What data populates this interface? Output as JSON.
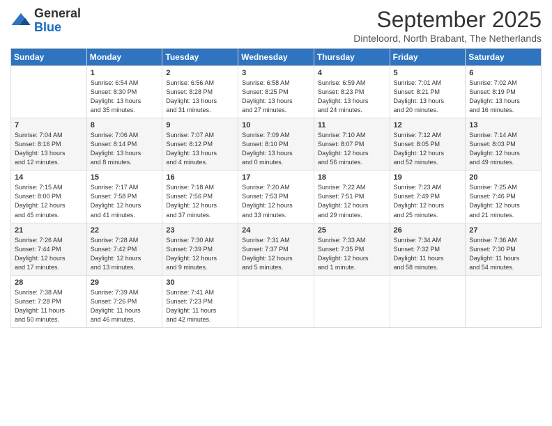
{
  "logo": {
    "general": "General",
    "blue": "Blue"
  },
  "title": "September 2025",
  "subtitle": "Dinteloord, North Brabant, The Netherlands",
  "weekdays": [
    "Sunday",
    "Monday",
    "Tuesday",
    "Wednesday",
    "Thursday",
    "Friday",
    "Saturday"
  ],
  "weeks": [
    [
      {
        "day": "",
        "info": ""
      },
      {
        "day": "1",
        "info": "Sunrise: 6:54 AM\nSunset: 8:30 PM\nDaylight: 13 hours\nand 35 minutes."
      },
      {
        "day": "2",
        "info": "Sunrise: 6:56 AM\nSunset: 8:28 PM\nDaylight: 13 hours\nand 31 minutes."
      },
      {
        "day": "3",
        "info": "Sunrise: 6:58 AM\nSunset: 8:25 PM\nDaylight: 13 hours\nand 27 minutes."
      },
      {
        "day": "4",
        "info": "Sunrise: 6:59 AM\nSunset: 8:23 PM\nDaylight: 13 hours\nand 24 minutes."
      },
      {
        "day": "5",
        "info": "Sunrise: 7:01 AM\nSunset: 8:21 PM\nDaylight: 13 hours\nand 20 minutes."
      },
      {
        "day": "6",
        "info": "Sunrise: 7:02 AM\nSunset: 8:19 PM\nDaylight: 13 hours\nand 16 minutes."
      }
    ],
    [
      {
        "day": "7",
        "info": "Sunrise: 7:04 AM\nSunset: 8:16 PM\nDaylight: 13 hours\nand 12 minutes."
      },
      {
        "day": "8",
        "info": "Sunrise: 7:06 AM\nSunset: 8:14 PM\nDaylight: 13 hours\nand 8 minutes."
      },
      {
        "day": "9",
        "info": "Sunrise: 7:07 AM\nSunset: 8:12 PM\nDaylight: 13 hours\nand 4 minutes."
      },
      {
        "day": "10",
        "info": "Sunrise: 7:09 AM\nSunset: 8:10 PM\nDaylight: 13 hours\nand 0 minutes."
      },
      {
        "day": "11",
        "info": "Sunrise: 7:10 AM\nSunset: 8:07 PM\nDaylight: 12 hours\nand 56 minutes."
      },
      {
        "day": "12",
        "info": "Sunrise: 7:12 AM\nSunset: 8:05 PM\nDaylight: 12 hours\nand 52 minutes."
      },
      {
        "day": "13",
        "info": "Sunrise: 7:14 AM\nSunset: 8:03 PM\nDaylight: 12 hours\nand 49 minutes."
      }
    ],
    [
      {
        "day": "14",
        "info": "Sunrise: 7:15 AM\nSunset: 8:00 PM\nDaylight: 12 hours\nand 45 minutes."
      },
      {
        "day": "15",
        "info": "Sunrise: 7:17 AM\nSunset: 7:58 PM\nDaylight: 12 hours\nand 41 minutes."
      },
      {
        "day": "16",
        "info": "Sunrise: 7:18 AM\nSunset: 7:56 PM\nDaylight: 12 hours\nand 37 minutes."
      },
      {
        "day": "17",
        "info": "Sunrise: 7:20 AM\nSunset: 7:53 PM\nDaylight: 12 hours\nand 33 minutes."
      },
      {
        "day": "18",
        "info": "Sunrise: 7:22 AM\nSunset: 7:51 PM\nDaylight: 12 hours\nand 29 minutes."
      },
      {
        "day": "19",
        "info": "Sunrise: 7:23 AM\nSunset: 7:49 PM\nDaylight: 12 hours\nand 25 minutes."
      },
      {
        "day": "20",
        "info": "Sunrise: 7:25 AM\nSunset: 7:46 PM\nDaylight: 12 hours\nand 21 minutes."
      }
    ],
    [
      {
        "day": "21",
        "info": "Sunrise: 7:26 AM\nSunset: 7:44 PM\nDaylight: 12 hours\nand 17 minutes."
      },
      {
        "day": "22",
        "info": "Sunrise: 7:28 AM\nSunset: 7:42 PM\nDaylight: 12 hours\nand 13 minutes."
      },
      {
        "day": "23",
        "info": "Sunrise: 7:30 AM\nSunset: 7:39 PM\nDaylight: 12 hours\nand 9 minutes."
      },
      {
        "day": "24",
        "info": "Sunrise: 7:31 AM\nSunset: 7:37 PM\nDaylight: 12 hours\nand 5 minutes."
      },
      {
        "day": "25",
        "info": "Sunrise: 7:33 AM\nSunset: 7:35 PM\nDaylight: 12 hours\nand 1 minute."
      },
      {
        "day": "26",
        "info": "Sunrise: 7:34 AM\nSunset: 7:32 PM\nDaylight: 11 hours\nand 58 minutes."
      },
      {
        "day": "27",
        "info": "Sunrise: 7:36 AM\nSunset: 7:30 PM\nDaylight: 11 hours\nand 54 minutes."
      }
    ],
    [
      {
        "day": "28",
        "info": "Sunrise: 7:38 AM\nSunset: 7:28 PM\nDaylight: 11 hours\nand 50 minutes."
      },
      {
        "day": "29",
        "info": "Sunrise: 7:39 AM\nSunset: 7:26 PM\nDaylight: 11 hours\nand 46 minutes."
      },
      {
        "day": "30",
        "info": "Sunrise: 7:41 AM\nSunset: 7:23 PM\nDaylight: 11 hours\nand 42 minutes."
      },
      {
        "day": "",
        "info": ""
      },
      {
        "day": "",
        "info": ""
      },
      {
        "day": "",
        "info": ""
      },
      {
        "day": "",
        "info": ""
      }
    ]
  ]
}
